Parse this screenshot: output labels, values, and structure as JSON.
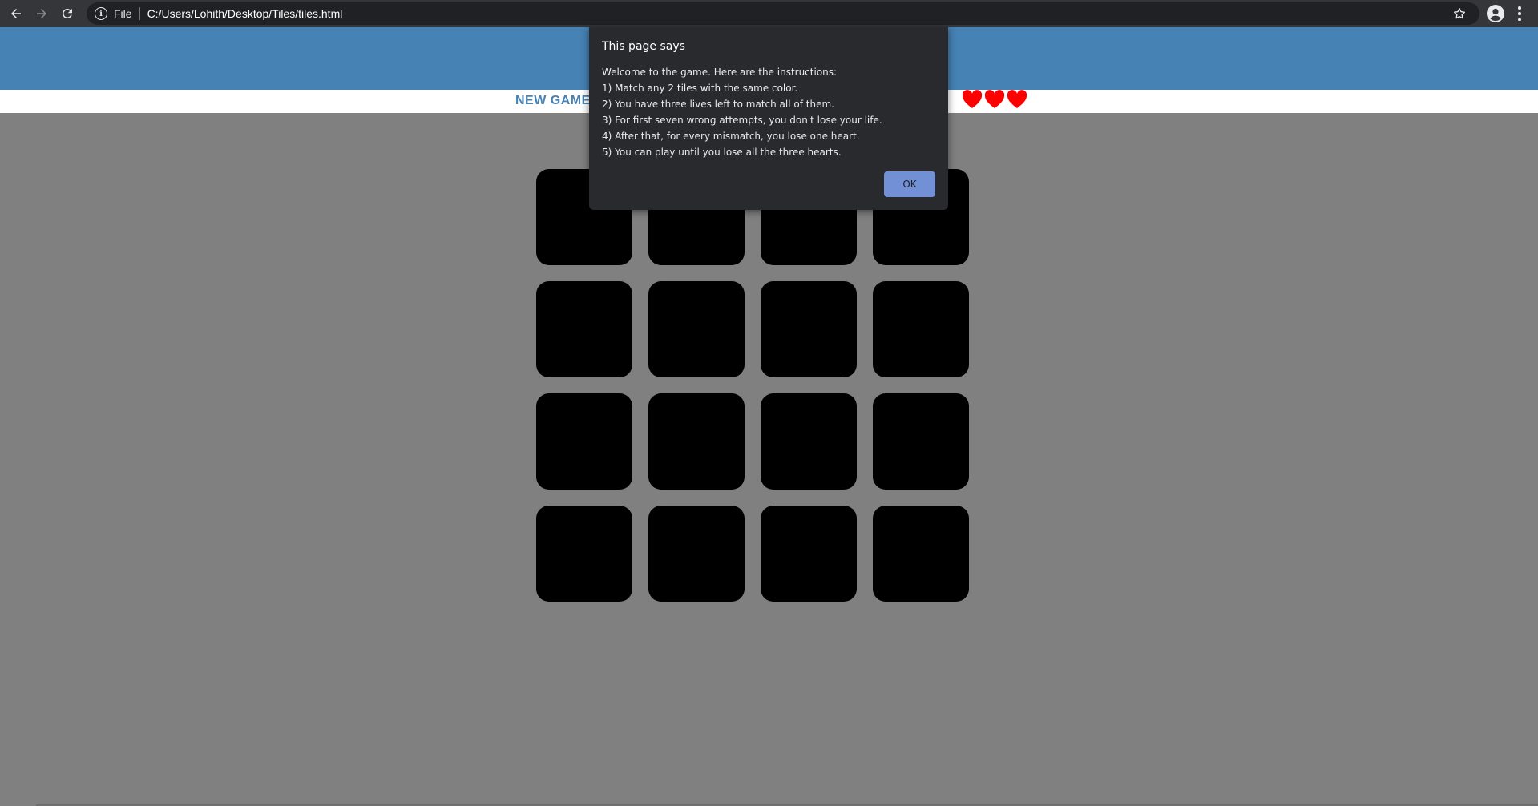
{
  "browser": {
    "scheme_label": "File",
    "url": "C:/Users/Lohith/Desktop/Tiles/tiles.html",
    "icons": [
      "back-arrow-icon",
      "forward-arrow-icon",
      "reload-icon",
      "info-icon",
      "star-icon",
      "profile-icon",
      "menu-icon"
    ]
  },
  "header": {
    "new_game_label": "NEW GAME",
    "lives": 3,
    "heart_color": "#ff0000"
  },
  "board": {
    "rows": 4,
    "cols": 4,
    "tile_color": "#000000"
  },
  "dialog": {
    "title": "This page says",
    "lines": [
      "Welcome to the game. Here are the instructions:",
      "1) Match any 2 tiles with the same color.",
      "2) You have three lives left to match all of them.",
      "3) For first seven wrong attempts, you don't lose your life.",
      "4) After that, for every mismatch, you lose one heart.",
      "5) You can play until you lose all the three hearts."
    ],
    "ok_label": "OK"
  },
  "colors": {
    "header_bg": "#4682b4",
    "page_bg": "#808080",
    "dialog_bg": "#292a2d",
    "ok_button": "#7190d6"
  }
}
